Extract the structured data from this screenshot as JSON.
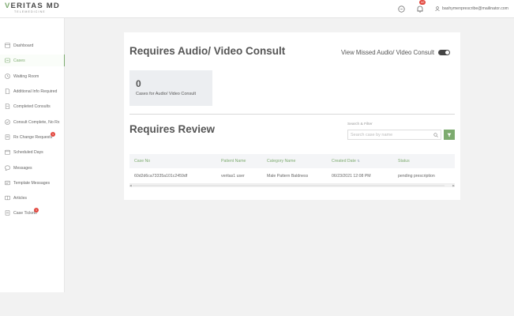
{
  "brand": {
    "name_first": "V",
    "name_rest": "ERITAS MD",
    "tagline": "TELEMEDICINE"
  },
  "header": {
    "notification_count": "42",
    "user_email": "bashymenprescribe@mailinator.com"
  },
  "sidebar": {
    "items": [
      {
        "label": "Dashboard",
        "icon": "dashboard-icon"
      },
      {
        "label": "Cases",
        "icon": "cases-icon",
        "active": true
      },
      {
        "label": "Waiting Room",
        "icon": "clock-icon"
      },
      {
        "label": "Additional Info Required",
        "icon": "document-icon"
      },
      {
        "label": "Completed Consults",
        "icon": "document-icon"
      },
      {
        "label": "Consult Complete, No Rx",
        "icon": "consult-icon"
      },
      {
        "label": "Rx Change Requests",
        "icon": "rx-icon",
        "badge": "1"
      },
      {
        "label": "Scheduled Days",
        "icon": "calendar-icon"
      },
      {
        "label": "Messages",
        "icon": "message-icon"
      },
      {
        "label": "Template Messages",
        "icon": "template-icon"
      },
      {
        "label": "Articles",
        "icon": "articles-icon"
      },
      {
        "label": "Case Tickets",
        "icon": "ticket-icon",
        "badge": "1"
      }
    ]
  },
  "consult": {
    "title": "Requires Audio/ Video Consult",
    "toggle_label": "View Missed Audio/ Video Consult",
    "stat_value": "0",
    "stat_label": "Cases for Audio/ Video Consult"
  },
  "review": {
    "title": "Requires Review",
    "search_label": "Search & Filter",
    "search_placeholder": "Search case by name",
    "columns": [
      "Case No",
      "Patient Name",
      "Category Name",
      "Created Date",
      "Status"
    ],
    "rows": [
      [
        "60d2d6ca73335a101c2459df",
        "veritas1 user",
        "Male Pattern Baldness",
        "06/23/2021 12:08 PM",
        "pending prescription"
      ]
    ]
  },
  "colors": {
    "accent": "#7dab6f",
    "badge": "#e2473e",
    "stat_bg": "#eceef1"
  }
}
